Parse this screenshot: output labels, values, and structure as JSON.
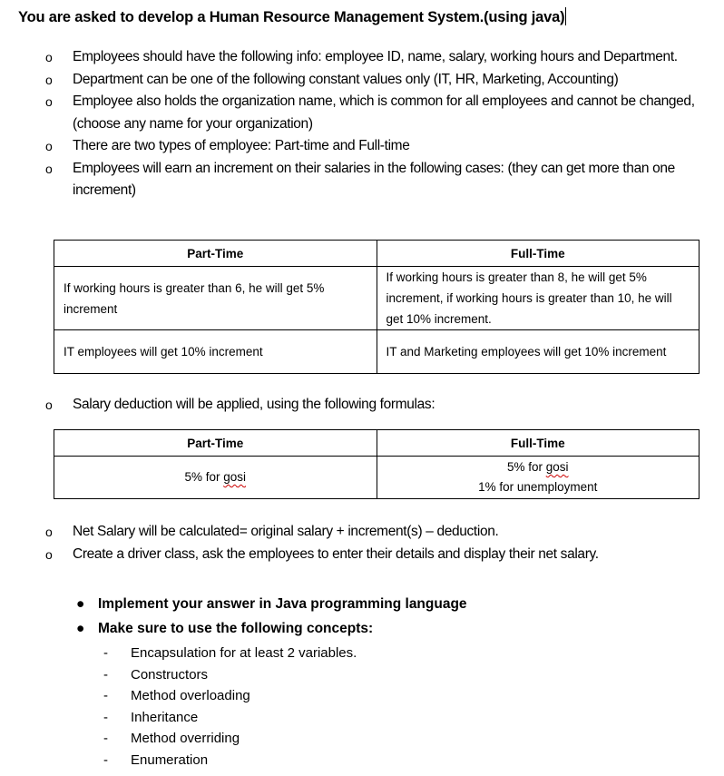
{
  "title": "You are asked to develop a Human Resource Management System.(using java)",
  "requirements": [
    {
      "text": "Employees should have the following info: employee ID, name, salary, working hours and Department."
    },
    {
      "text": "Department can be one of the following constant values only (IT, HR, Marketing, Accounting)"
    },
    {
      "text": "Employee also holds the organization name, which is common for all employees and cannot be changed, (choose any name for your organization)"
    },
    {
      "text": "There are two types of employee: Part-time and Full-time"
    },
    {
      "text": "Employees will earn an increment on their salaries in the following cases: (they can get more than one increment)"
    }
  ],
  "increment_table": {
    "headers": [
      "Part-Time",
      "Full-Time"
    ],
    "rows": [
      [
        "If working hours is greater than 6, he will get 5% increment",
        "If working hours is greater than 8, he will get 5% increment, if working hours is greater than 10, he will get 10% increment."
      ],
      [
        "IT employees will get 10% increment",
        "IT and Marketing employees will get 10% increment"
      ]
    ]
  },
  "deduction_intro": "Salary deduction will be applied, using the following formulas:",
  "deduction_table": {
    "headers": [
      "Part-Time",
      "Full-Time"
    ],
    "part_time": {
      "prefix": "5% for ",
      "word": "gosi"
    },
    "full_time": [
      {
        "prefix": "5% for ",
        "word": "gosi"
      },
      {
        "prefix": "1% for unemployment",
        "word": ""
      }
    ]
  },
  "final_requirements": [
    {
      "text": "Net Salary will be calculated= original salary + increment(s) – deduction."
    },
    {
      "text": "Create a driver class, ask the employees to enter their details and display their net salary."
    }
  ],
  "instructions": [
    {
      "text": "Implement your answer in Java programming  language"
    },
    {
      "text": "Make sure to use the following concepts:"
    }
  ],
  "concepts": [
    "Encapsulation for at least 2 variables.",
    "Constructors",
    "Method overloading",
    "Inheritance",
    "Method overriding",
    "Enumeration"
  ],
  "bullets": {
    "hollow": "o",
    "solid": "●",
    "dash": "-"
  }
}
